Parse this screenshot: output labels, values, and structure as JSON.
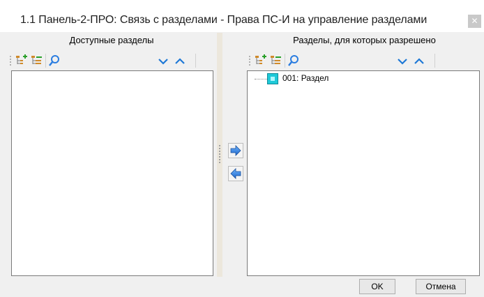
{
  "window": {
    "title": "1.1 Панель-2-ПРО: Связь с разделами - Права ПС-И на управление разделами",
    "close_icon": "close-icon"
  },
  "left_panel": {
    "header": "Доступные разделы",
    "toolbar": [
      "add-child-node-icon",
      "tree-outline-icon",
      "search-icon",
      "chevron-down-icon",
      "chevron-up-icon"
    ],
    "items": []
  },
  "right_panel": {
    "header": "Разделы, для которых разрешено",
    "toolbar": [
      "add-child-node-icon",
      "tree-outline-icon",
      "search-icon",
      "chevron-down-icon",
      "chevron-up-icon"
    ],
    "items": [
      {
        "label": "001: Раздел",
        "icon": "section-icon"
      }
    ]
  },
  "transfer": {
    "add_icon": "arrow-right-icon",
    "remove_icon": "arrow-left-icon"
  },
  "buttons": {
    "ok": "OK",
    "cancel": "Отмена"
  },
  "colors": {
    "accent": "#2b7de0",
    "node": "#1ec9d8"
  }
}
